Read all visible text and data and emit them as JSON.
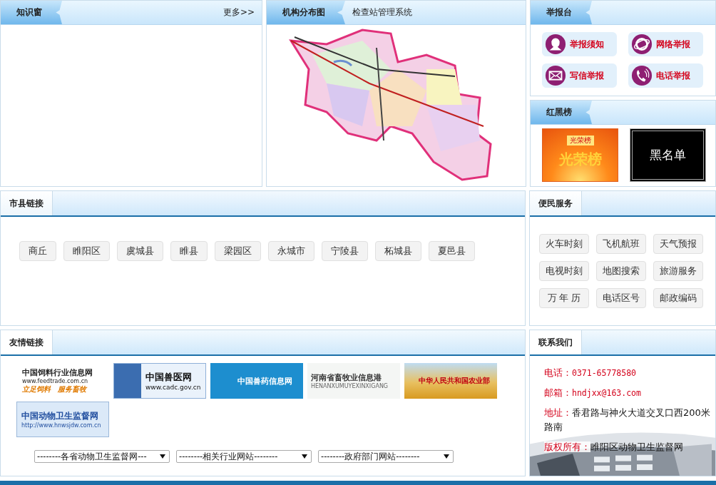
{
  "knowledge": {
    "title": "知识窗",
    "more": "更多>>"
  },
  "map_panel": {
    "title": "机构分布图",
    "subtitle": "检查站管理系统",
    "kind": "picture"
  },
  "report": {
    "title": "举报台",
    "buttons": [
      {
        "label": "举报须知",
        "kind": "person"
      },
      {
        "label": "网络举报",
        "kind": "browser"
      },
      {
        "label": "写信举报",
        "kind": "mail"
      },
      {
        "label": "电话举报",
        "kind": "phone"
      }
    ]
  },
  "honor": {
    "title": "红黑榜",
    "cards": [
      {
        "kind": "honor",
        "heading": "光荣榜",
        "label": "光荣榜"
      },
      {
        "kind": "black",
        "label": "黑名单"
      }
    ]
  },
  "county_links": {
    "title": "市县链接",
    "items": [
      "商丘",
      "睢阳区",
      "虞城县",
      "睢县",
      "梁园区",
      "永城市",
      "宁陵县",
      "柘城县",
      "夏邑县"
    ]
  },
  "services": {
    "title": "便民服务",
    "items": [
      "火车时刻",
      "飞机航班",
      "天气预报",
      "电视时刻",
      "地图搜索",
      "旅游服务",
      "万 年 历",
      "电话区号",
      "邮政编码"
    ]
  },
  "friend_links": {
    "title": "友情链接",
    "banners": [
      {
        "kind": "feed",
        "title": "中国饲料行业信息网",
        "subtitle": "www.feedtrade.com.cn",
        "tagline": "立足饲料　服务畜牧"
      },
      {
        "kind": "vet",
        "title": "中国兽医网",
        "subtitle": "www.cadc.gov.cn"
      },
      {
        "kind": "drug",
        "title": "中国兽药信息网"
      },
      {
        "kind": "henan",
        "title": "河南省畜牧业信息港",
        "subtitle": "HENANXUMUYEXINXIGANG"
      },
      {
        "kind": "ministry",
        "title": "中华人民共和国农业部"
      },
      {
        "kind": "supervise",
        "title": "中国动物卫生监督网",
        "subtitle": "http://www.hnwsjdw.com.cn"
      }
    ],
    "dropdowns": [
      "--------各省动物卫生监督网---",
      "--------相关行业网站--------",
      "--------政府部门网站--------"
    ]
  },
  "contact": {
    "title": "联系我们",
    "lines": [
      {
        "label": "电话：",
        "value": "0371-65778580",
        "emphasis": true
      },
      {
        "label": "邮箱：",
        "value": "hndjxx@163.com",
        "emphasis": true
      },
      {
        "label": "地址：",
        "value": "香君路与神火大道交叉口西200米路南",
        "emphasis": false
      },
      {
        "label": "版权所有：",
        "value": "睢阳区动物卫生监督网",
        "emphasis": false
      }
    ]
  }
}
